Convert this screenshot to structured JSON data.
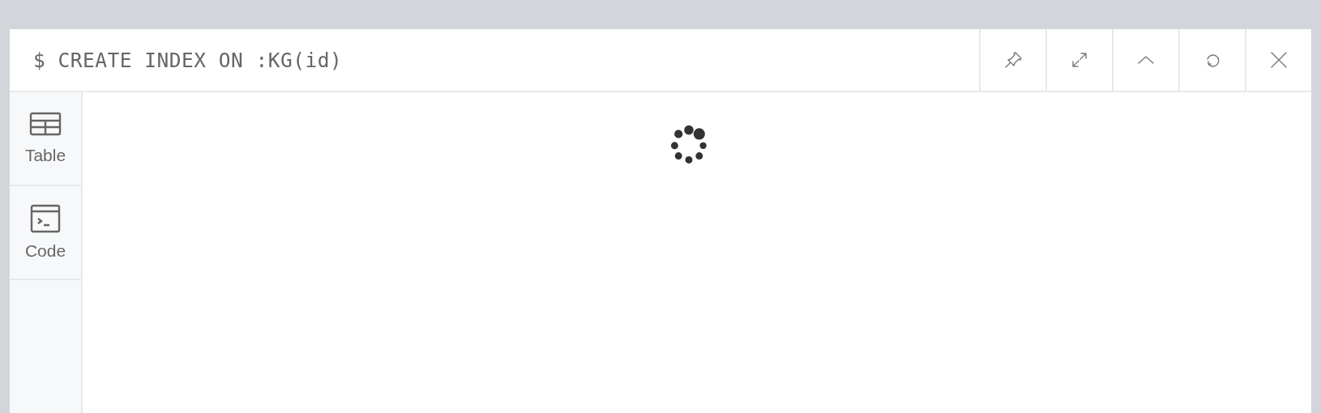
{
  "frame": {
    "command": "$ CREATE INDEX ON :KG(id)",
    "actions": [
      {
        "kind": "pin"
      },
      {
        "kind": "expand"
      },
      {
        "kind": "collapse"
      },
      {
        "kind": "rerun"
      },
      {
        "kind": "close"
      }
    ]
  },
  "sidebar": {
    "items": [
      {
        "label": "Table",
        "kind": "table"
      },
      {
        "label": "Code",
        "kind": "code"
      }
    ]
  }
}
